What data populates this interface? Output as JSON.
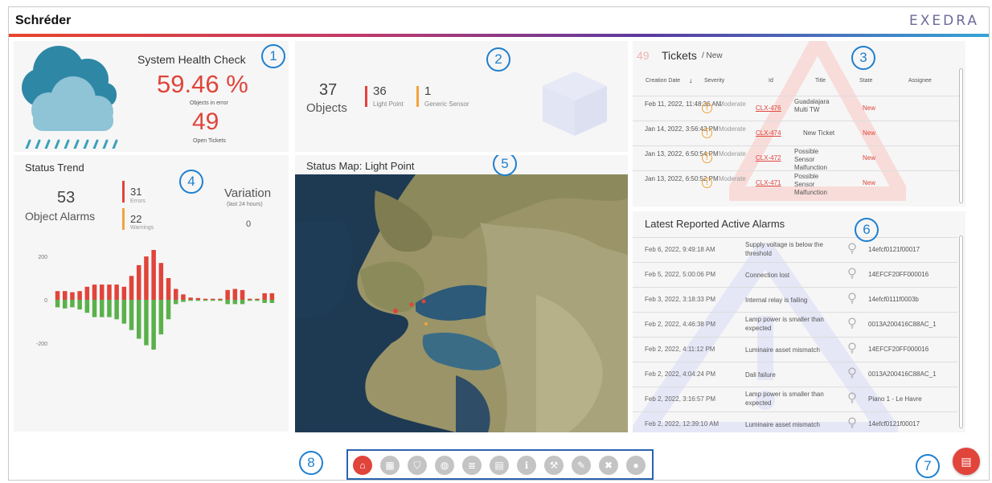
{
  "header": {
    "brand": "Schréder",
    "product": "EXEDRA"
  },
  "markers": [
    "1",
    "2",
    "3",
    "4",
    "5",
    "6",
    "7",
    "8"
  ],
  "health": {
    "title": "System Health Check",
    "percent": "59.46 %",
    "percent_label": "Objects in error",
    "tickets": "49",
    "tickets_label": "Open Tickets"
  },
  "objects": {
    "count": "37",
    "label": "Objects",
    "light_point_count": "36",
    "light_point_label": "Light Point",
    "sensor_count": "1",
    "sensor_label": "Generic Sensor"
  },
  "tickets": {
    "count": "49",
    "title": "Tickets",
    "subtitle": "/ New",
    "columns": [
      "Creation Date",
      "Severity",
      "Id",
      "Title",
      "State",
      "Assignee"
    ],
    "rows": [
      {
        "date": "Feb 11, 2022, 11:48:36 AM",
        "severity": "Moderate",
        "id": "CLX-476",
        "title": "Guadalajara Multi TW",
        "state": "New"
      },
      {
        "date": "Jan 14, 2022, 3:56:43 PM",
        "severity": "Moderate",
        "id": "CLX-474",
        "title": "New Ticket",
        "state": "New"
      },
      {
        "date": "Jan 13, 2022, 6:50:54 PM",
        "severity": "Moderate",
        "id": "CLX-472",
        "title": "Possible Sensor Malfunction",
        "state": "New"
      },
      {
        "date": "Jan 13, 2022, 6:50:52 PM",
        "severity": "Moderate",
        "id": "CLX-471",
        "title": "Possible Sensor Malfunction",
        "state": "New"
      }
    ]
  },
  "trend": {
    "title": "Status Trend",
    "alarms": "53",
    "alarms_label": "Object Alarms",
    "errors": "31",
    "errors_label": "Errors",
    "warnings": "22",
    "warnings_label": "Warnings",
    "variation_label": "Variation",
    "variation_period": "(last 24 hours)",
    "variation_value": "0"
  },
  "chart_data": {
    "type": "bar",
    "yticks": [
      200,
      0,
      -200
    ],
    "ylim": [
      -230,
      230
    ],
    "series": [
      {
        "values": [
          40,
          40,
          35,
          40,
          60,
          70,
          70,
          70,
          70,
          60,
          110,
          160,
          200,
          230,
          170,
          100,
          50,
          25,
          10,
          8,
          5,
          5,
          5,
          45,
          50,
          45,
          5,
          5,
          30,
          30
        ]
      },
      {
        "values": [
          -35,
          -40,
          -35,
          -45,
          -60,
          -80,
          -80,
          -80,
          -90,
          -110,
          -140,
          -180,
          -210,
          -230,
          -160,
          -90,
          -20,
          -10,
          -5,
          -5,
          -5,
          -5,
          -5,
          -20,
          -20,
          -20,
          -5,
          -5,
          -15,
          -15
        ]
      }
    ],
    "colors": [
      "#e0443b",
      "#5ab14b"
    ]
  },
  "map": {
    "title": "Status Map: Light Point"
  },
  "alarms": {
    "title": "Latest Reported Active Alarms",
    "rows": [
      {
        "date": "Feb 6, 2022, 9:49:18 AM",
        "desc": "Supply voltage is below the threshold",
        "id": "14efcf0121f00017"
      },
      {
        "date": "Feb 5, 2022, 5:00:06 PM",
        "desc": "Connection lost",
        "id": "14EFCF20FF000016"
      },
      {
        "date": "Feb 3, 2022, 3:18:33 PM",
        "desc": "Internal relay is failing",
        "id": "14efcf0111f0003b"
      },
      {
        "date": "Feb 2, 2022, 4:46:38 PM",
        "desc": "Lamp power is smaller than expected",
        "id": "0013A200416C88AC_1"
      },
      {
        "date": "Feb 2, 2022, 4:11:12 PM",
        "desc": "Luminaire asset mismatch",
        "id": "14EFCF20FF000016"
      },
      {
        "date": "Feb 2, 2022, 4:04:24 PM",
        "desc": "Dali failure",
        "id": "0013A200416C88AC_1"
      },
      {
        "date": "Feb 2, 2022, 3:16:57 PM",
        "desc": "Lamp power is smaller than expected",
        "id": "Piano 1 - Le Havre"
      },
      {
        "date": "Feb 2, 2022, 12:39:10 AM",
        "desc": "Luminaire asset mismatch",
        "id": "14efcf0121f00017"
      }
    ]
  },
  "toolbar": {
    "buttons": [
      {
        "name": "home-icon",
        "glyph": "⌂"
      },
      {
        "name": "dashboard-icon",
        "glyph": "▦"
      },
      {
        "name": "shield-icon",
        "glyph": "⛉"
      },
      {
        "name": "lightbulb-icon",
        "glyph": "◍"
      },
      {
        "name": "list-icon",
        "glyph": "≣"
      },
      {
        "name": "report-icon",
        "glyph": "▤"
      },
      {
        "name": "info-icon",
        "glyph": "ℹ"
      },
      {
        "name": "wrench-icon",
        "glyph": "⚒"
      },
      {
        "name": "settings-icon",
        "glyph": "✎"
      },
      {
        "name": "tools-icon",
        "glyph": "✖"
      },
      {
        "name": "user-icon",
        "glyph": "●"
      }
    ]
  },
  "fab": {
    "glyph": "▤"
  }
}
